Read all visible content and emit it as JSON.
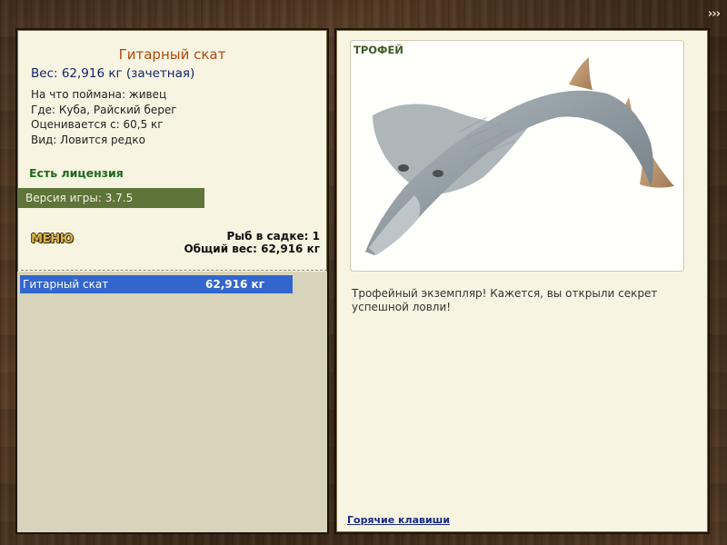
{
  "topbar": {
    "forward_label": "›››",
    "forward_icon": "triple-chevron-right-icon"
  },
  "fish": {
    "name": "Гитарный скат",
    "weight_line": "Вес: 62,916 кг (зачетная)",
    "info": [
      "На что поймана: живец",
      "Где: Куба, Райский берег",
      "Оценивается с: 60,5 кг",
      "Вид: Ловится редко"
    ]
  },
  "license": "Есть лицензия",
  "version": "Версия игры: 3.7.5",
  "menu_label": "МЕНЮ",
  "keep": {
    "count_line": "Рыб в садке: 1",
    "total_line": "Общий вес: 62,916 кг"
  },
  "catch_list": [
    {
      "name": "Гитарный скат",
      "weight": "62,916 кг"
    }
  ],
  "trophy": {
    "label": "ТРОФЕЙ",
    "text": "Трофейный экземпляр! Кажется, вы открыли секрет успешной ловли!"
  },
  "hotkeys_label": "Горячие клавиши",
  "colors": {
    "panel_bg": "#f7f4e1",
    "title": "#b0480d",
    "weight": "#142569",
    "license": "#1d6a1d",
    "version_bg": "#5e7438",
    "selected_row": "#3366cc",
    "trophy_label": "#3c5d27"
  }
}
